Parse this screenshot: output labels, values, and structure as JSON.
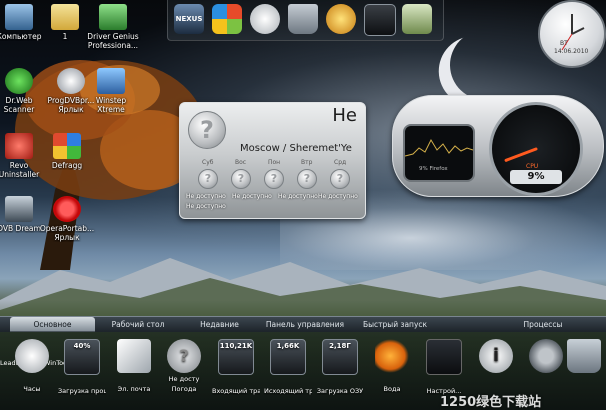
{
  "desktop_icons": [
    {
      "label": "Компьютер",
      "icon": "computer-icon"
    },
    {
      "label": "1",
      "icon": "folder-icon"
    },
    {
      "label": "Driver Genius",
      "label2": "Professiona...",
      "icon": "driver-genius-icon"
    },
    {
      "label": "Dr.Web",
      "label2": "Scanner",
      "icon": "drweb-icon"
    },
    {
      "label": "ProgDVBpr...",
      "label2": "Ярлык",
      "icon": "satellite-icon"
    },
    {
      "label": "Winstep",
      "label2": "Xtreme",
      "icon": "winstep-icon"
    },
    {
      "label": "Revo",
      "label2": "Uninstaller",
      "icon": "revo-icon"
    },
    {
      "label": "Defragg",
      "icon": "defragg-icon"
    },
    {
      "label": "DVB Dream",
      "icon": "dvb-dream-icon"
    },
    {
      "label": "OperaPortab...",
      "label2": "Ярлык",
      "icon": "opera-icon"
    }
  ],
  "dock": {
    "items": [
      "nexus-logo",
      "windows-flag-icon",
      "clock-icon",
      "recycle-bin-icon",
      "web-icon",
      "camera-icon",
      "folder-icon",
      "clock-icon"
    ],
    "logo_text": "NEXUS"
  },
  "clock_gadget": {
    "day": "ВТ",
    "date": "14.06.2010"
  },
  "weather": {
    "temp_text": "Не",
    "location": "Moscow / Sheremet'Ye",
    "days": [
      "Суб",
      "Вос",
      "Пон",
      "Втр",
      "Срд"
    ],
    "status": "Не доступно"
  },
  "cpu_gadget": {
    "label": "CPU",
    "value": "9%",
    "sub": "9% Firefox",
    "load_percent": 9
  },
  "taskbar": {
    "tabs": [
      "Основное",
      "Рабочий стол",
      "Недавние",
      "Панель управления",
      "Быстрый запуск",
      "Процессы"
    ],
    "active_tab": "Основное",
    "left_labels": [
      "Leadt...",
      "WinToo..."
    ],
    "items": [
      {
        "label": "Часы",
        "icon": "clock-icon"
      },
      {
        "label": "Загрузка процесс",
        "value": "40%",
        "icon": "cpu-meter-icon"
      },
      {
        "label": "Эл. почта",
        "icon": "mail-icon"
      },
      {
        "label": "Погода",
        "value": "Не досту",
        "icon": "weather-icon"
      },
      {
        "label": "Входящий траф",
        "value": "110,21K",
        "icon": "download-meter-icon"
      },
      {
        "label": "Исходящий траф",
        "value": "1,66K",
        "icon": "upload-meter-icon"
      },
      {
        "label": "Загрузка ОЗУ",
        "value": "2,18Г",
        "icon": "ram-meter-icon"
      },
      {
        "label": "Вода",
        "icon": "goldfish-icon"
      },
      {
        "label": "Настрой...",
        "icon": "nexus-settings-icon"
      },
      {
        "label": "",
        "icon": "info-icon"
      },
      {
        "label": "",
        "icon": "gear-icon"
      },
      {
        "label": "",
        "icon": "recycle-bin-icon"
      }
    ]
  },
  "watermark": "1250绿色下载站"
}
